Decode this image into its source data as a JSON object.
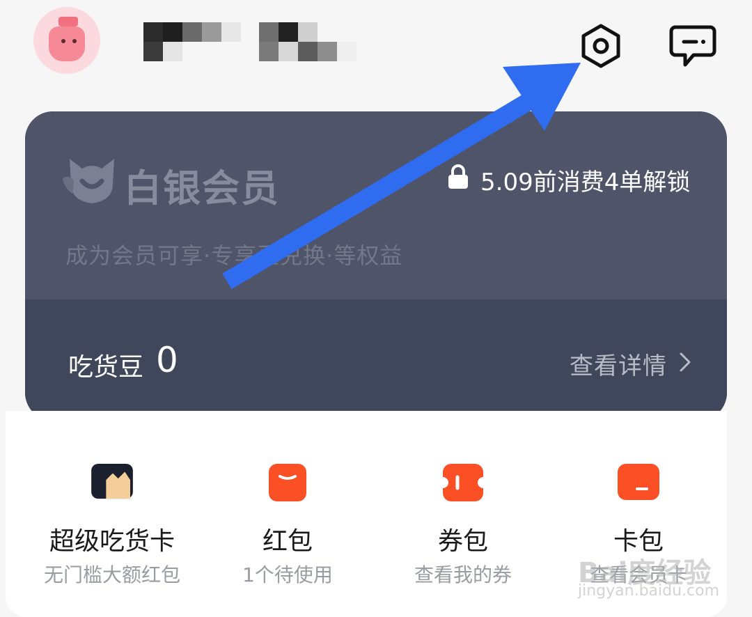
{
  "header": {
    "avatar_icon": "bottle-mascot-avatar",
    "username_obscured": true,
    "settings_icon": "gear-hex-icon",
    "message_icon": "chat-bubble-icon"
  },
  "membership": {
    "tier_name": "白银会员",
    "unlock_text": "5.09前消费4单解锁",
    "benefit_text": "成为会员可享·专享豆兑换·等权益",
    "beans_label": "吃货豆",
    "beans_value": "0",
    "detail_link": "查看详情"
  },
  "entries": [
    {
      "title": "超级吃货卡",
      "subtitle": "无门槛大额红包",
      "icon": "crown-card-icon",
      "color": "#1c1f2e"
    },
    {
      "title": "红包",
      "subtitle": "1个待使用",
      "icon": "red-envelope-icon",
      "color": "#fb4f26"
    },
    {
      "title": "券包",
      "subtitle": "查看我的券",
      "icon": "coupon-ticket-icon",
      "color": "#fb4f26"
    },
    {
      "title": "卡包",
      "subtitle": "查看会员卡",
      "icon": "card-wallet-icon",
      "color": "#fb4f26"
    }
  ],
  "watermark": {
    "brand": "Bai度经验",
    "url": "jingyan.baidu.com"
  },
  "colors": {
    "card_bg": "#4a4f63",
    "arrow": "#2f6cf0",
    "accent_orange": "#fb4f26"
  }
}
